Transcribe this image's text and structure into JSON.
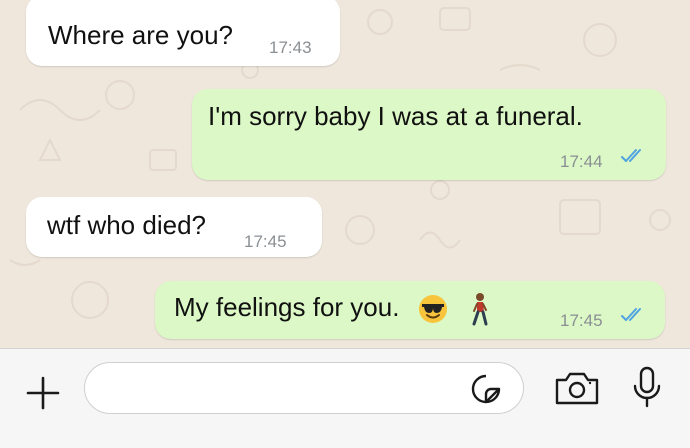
{
  "messages": [
    {
      "direction": "incoming",
      "text": "Where are you?",
      "time": "17:43"
    },
    {
      "direction": "outgoing",
      "text": "I'm sorry baby I was at a funeral.",
      "time": "17:44",
      "status": "read"
    },
    {
      "direction": "incoming",
      "text": "wtf who died?",
      "time": "17:45"
    },
    {
      "direction": "outgoing",
      "text": "My feelings for you.",
      "time": "17:45",
      "status": "read",
      "emojis": [
        "smiling-face-with-sunglasses",
        "person-walking"
      ]
    }
  ],
  "composer": {
    "value": "",
    "placeholder": "",
    "icons": [
      "plus-icon",
      "sticker-icon",
      "camera-icon",
      "microphone-icon"
    ]
  },
  "colors": {
    "chat_background": "#efe7dc",
    "incoming_bubble": "#ffffff",
    "outgoing_bubble": "#dcf8c6",
    "read_ticks": "#4fa3e0",
    "icon_color": "#1a1a1a"
  }
}
